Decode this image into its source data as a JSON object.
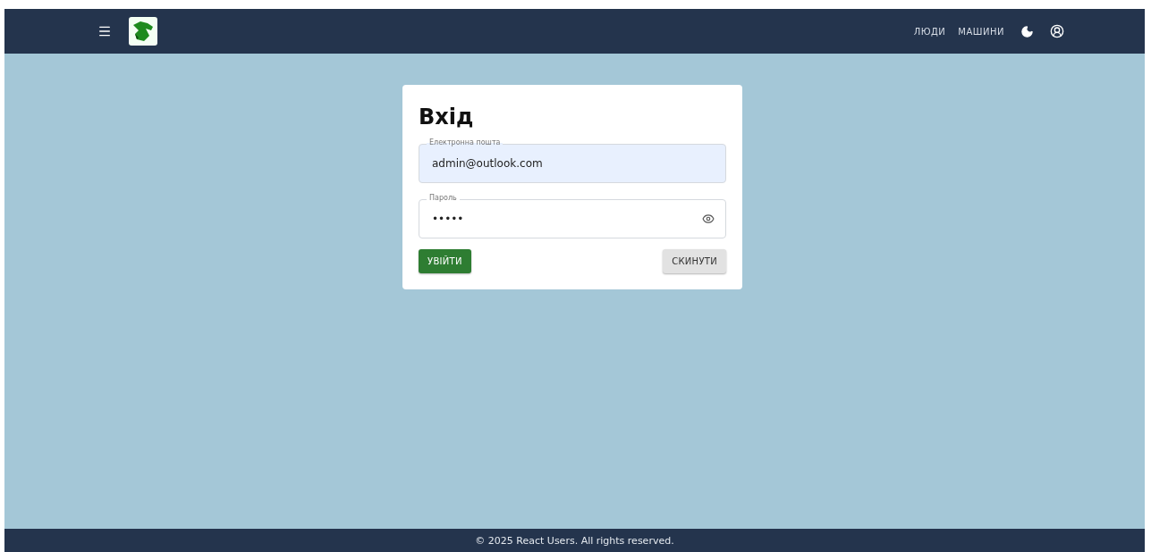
{
  "header": {
    "nav": [
      {
        "label": "ЛЮДИ"
      },
      {
        "label": "МАШИНИ"
      }
    ]
  },
  "login": {
    "title": "Вхід",
    "fields": [
      {
        "kind": "text",
        "label": "Електронна пошта",
        "value": "admin@outlook.com",
        "autofilled": true
      },
      {
        "kind": "password",
        "label": "Пароль",
        "value": "•••••",
        "autofilled": false
      }
    ],
    "buttons": [
      {
        "label": "УВІЙТИ",
        "kind": "primary"
      },
      {
        "label": "СКИНУТИ",
        "kind": "secondary"
      }
    ]
  },
  "footer": {
    "text": "© 2025 React Users. All rights reserved."
  }
}
